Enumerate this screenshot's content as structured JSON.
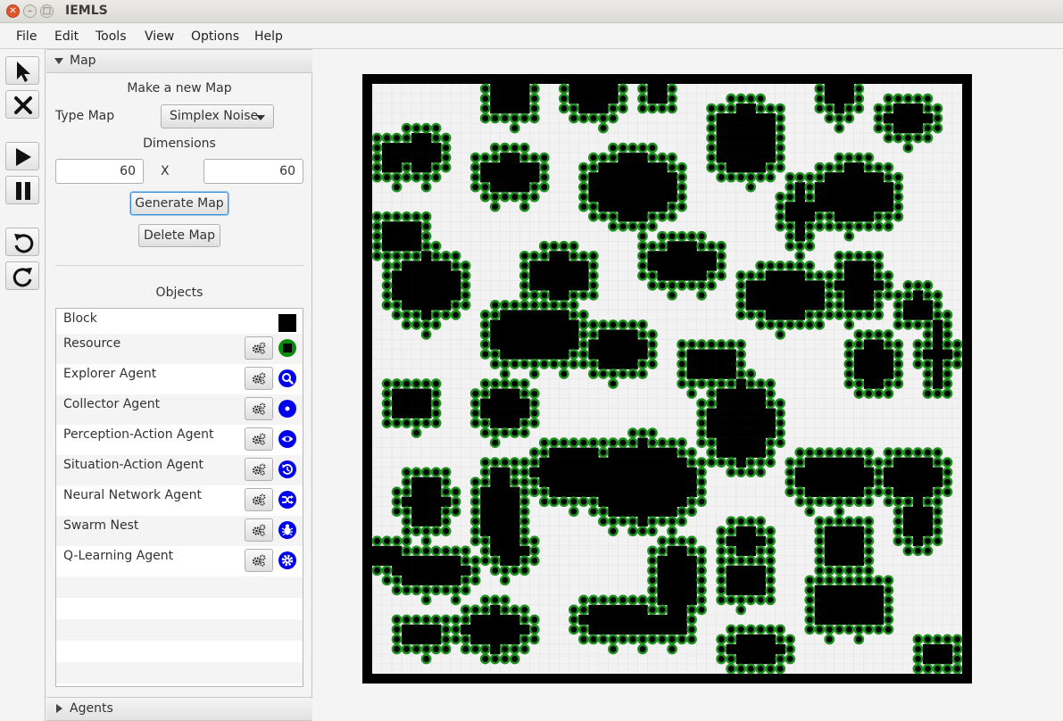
{
  "window": {
    "title": "IEMLS"
  },
  "menu": [
    "File",
    "Edit",
    "Tools",
    "View",
    "Options",
    "Help"
  ],
  "toolbar": {
    "tools": [
      "select-tool",
      "delete-tool",
      "play",
      "pause",
      "undo",
      "redo"
    ]
  },
  "map_panel": {
    "section_label": "Map",
    "heading": "Make a new Map",
    "type_label": "Type Map",
    "type_value": "Simplex Noise",
    "dimensions_label": "Dimensions",
    "width": "60",
    "x_label": "X",
    "height": "60",
    "generate_label": "Generate Map",
    "delete_label": "Delete Map",
    "objects_label": "Objects"
  },
  "objects": [
    {
      "name": "Block",
      "icon": "black-square",
      "color": "#000000"
    },
    {
      "name": "Resource",
      "icon": "resource-green-circle",
      "color": "#0a8a0a"
    },
    {
      "name": "Explorer Agent",
      "icon": "magnifier-blue",
      "color": "#0000ee"
    },
    {
      "name": "Collector Agent",
      "icon": "dot-blue",
      "color": "#0000ee"
    },
    {
      "name": "Perception-Action Agent",
      "icon": "eye-blue",
      "color": "#0000ee"
    },
    {
      "name": "Situation-Action Agent",
      "icon": "history-blue",
      "color": "#0000ee"
    },
    {
      "name": "Neural Network Agent",
      "icon": "shuffle-blue",
      "color": "#0000ee"
    },
    {
      "name": "Swarm Nest",
      "icon": "bug-blue",
      "color": "#0000ee"
    },
    {
      "name": "Q-Learning Agent",
      "icon": "gear-blue",
      "color": "#0000ee"
    }
  ],
  "agents_section_label": "Agents",
  "grid_map": {
    "cols": 60,
    "rows": 60,
    "colors": {
      "block": "#000000",
      "resource_ring": "#1f8f1f",
      "background": "#f2f2f2",
      "grid": "#e0e0e0"
    },
    "blobs": [
      [
        14.0,
        1.2,
        2.0,
        2.0
      ],
      [
        22.5,
        1.2,
        3.0,
        1.4
      ],
      [
        29.0,
        1.0,
        1.5,
        1.5
      ],
      [
        47.5,
        1.0,
        1.5,
        1.5
      ],
      [
        54.5,
        3.6,
        2.5,
        1.3
      ],
      [
        5.0,
        7.0,
        2.0,
        1.8
      ],
      [
        14.0,
        9.2,
        2.8,
        2.0
      ],
      [
        26.5,
        10.5,
        4.5,
        3.2
      ],
      [
        38.0,
        5.8,
        3.5,
        3.5
      ],
      [
        49.0,
        11.2,
        4.0,
        2.8
      ],
      [
        43.5,
        13.0,
        1.2,
        2.5
      ],
      [
        3.0,
        15.5,
        2.0,
        1.8
      ],
      [
        5.5,
        20.5,
        3.5,
        3.0
      ],
      [
        19.0,
        19.5,
        3.0,
        2.2
      ],
      [
        16.5,
        25.5,
        4.5,
        2.8
      ],
      [
        31.5,
        18.2,
        3.5,
        2.0
      ],
      [
        42.0,
        21.5,
        4.0,
        2.2
      ],
      [
        55.5,
        22.8,
        1.5,
        1.5
      ],
      [
        4.0,
        32.5,
        2.3,
        1.8
      ],
      [
        13.5,
        33.0,
        2.5,
        2.0
      ],
      [
        37.5,
        34.5,
        3.2,
        4.0
      ],
      [
        49.5,
        20.5,
        2.0,
        2.8
      ],
      [
        51.0,
        28.5,
        2.0,
        3.0
      ],
      [
        27.5,
        40.5,
        5.2,
        4.0
      ],
      [
        20.5,
        39.5,
        4.0,
        2.5
      ],
      [
        13.0,
        43.5,
        2.0,
        4.5
      ],
      [
        5.5,
        42.5,
        2.0,
        2.5
      ],
      [
        14.0,
        47.5,
        1.5,
        2.0
      ],
      [
        47.0,
        40.0,
        4.0,
        2.5
      ],
      [
        55.0,
        40.0,
        3.5,
        2.0
      ],
      [
        48.0,
        47.0,
        2.5,
        2.2
      ],
      [
        55.5,
        44.5,
        1.5,
        2.0
      ],
      [
        1.5,
        48.0,
        2.0,
        1.2
      ],
      [
        6.0,
        49.5,
        3.5,
        2.0
      ],
      [
        5.0,
        56.0,
        2.0,
        1.5
      ],
      [
        12.5,
        55.5,
        3.0,
        2.0
      ],
      [
        25.0,
        54.5,
        4.0,
        1.8
      ],
      [
        31.0,
        50.5,
        2.0,
        4.0
      ],
      [
        48.5,
        53.0,
        4.0,
        2.3
      ],
      [
        39.0,
        57.5,
        3.0,
        1.2
      ],
      [
        57.5,
        58.0,
        1.2,
        1.2
      ],
      [
        27.0,
        55.0,
        5.0,
        1.5
      ],
      [
        34.5,
        28.5,
        2.5,
        1.8
      ],
      [
        25.0,
        27.0,
        3.5,
        1.8
      ],
      [
        38.0,
        46.5,
        1.5,
        2.0
      ],
      [
        38.0,
        50.5,
        2.0,
        2.0
      ],
      [
        57.5,
        27.5,
        1.0,
        3.0
      ],
      [
        2.0,
        7.5,
        1.2,
        1.5
      ]
    ]
  }
}
